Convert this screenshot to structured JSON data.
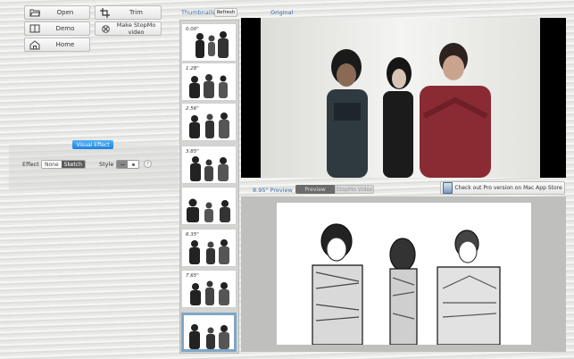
{
  "left_panel": {
    "buttons": [
      {
        "label": "Open",
        "icon": "folder-icon"
      },
      {
        "label": "Demo",
        "icon": "book-icon"
      },
      {
        "label": "Home",
        "icon": "house-icon"
      },
      {
        "label": "Trim",
        "icon": "crop-icon"
      },
      {
        "label": "Make StopMo video",
        "icon": "film-reel-icon"
      }
    ],
    "visual_effect": {
      "title": "Visual Effect",
      "effect_label": "Effect",
      "effect_options": [
        "None",
        "Sketch"
      ],
      "effect_selected": "Sketch",
      "style_label": "Style"
    }
  },
  "thumbnails": {
    "title": "Thumbnails",
    "refresh_label": "Refresh",
    "items": [
      {
        "time": "0.00\""
      },
      {
        "time": "1.28\""
      },
      {
        "time": "2.56\""
      },
      {
        "time": "3.85\""
      },
      {
        "time": ""
      },
      {
        "time": "6.35\""
      },
      {
        "time": "7.65\""
      },
      {
        "time": ""
      }
    ],
    "selected_index": 7
  },
  "original": {
    "title": "Original"
  },
  "preview": {
    "time_label": "8.95\" Preview",
    "tabs": [
      "Preview",
      "StopMo Video"
    ],
    "active_tab": "Preview",
    "pro_button": "Check out Pro version on Mac App Store"
  },
  "colors": {
    "accent": "#1f8fe8",
    "shirt_red": "#8a2b33"
  }
}
